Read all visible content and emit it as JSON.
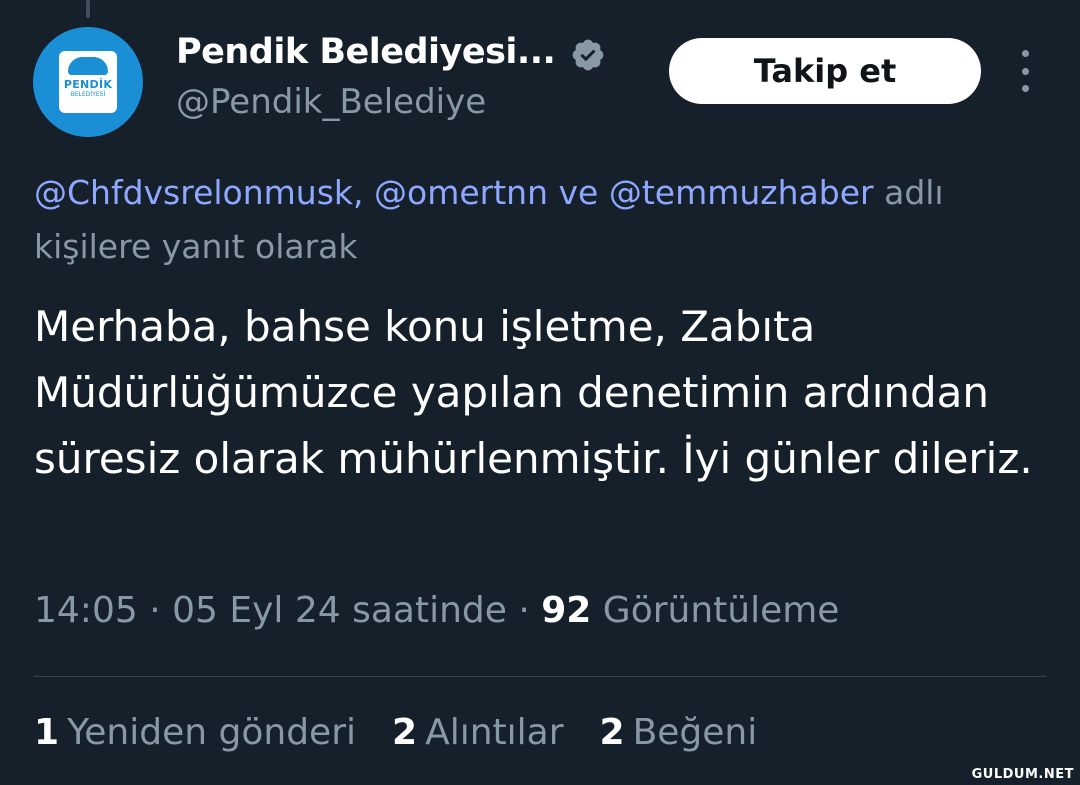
{
  "author": {
    "display_name": "Pendik Belediyesi...",
    "handle": "@Pendik_Belediye",
    "avatar_logo_name": "PENDİK",
    "avatar_logo_sub": "BELEDİYESİ",
    "avatar_color": "#1a8fd6",
    "verified_icon": "verified-badge-icon"
  },
  "follow_button": {
    "label": "Takip et"
  },
  "more_button": {
    "icon": "more-vertical-icon"
  },
  "reply_context": {
    "mentions": [
      "@Chfdvsrelonmusk,",
      "@omertnn",
      "@temmuzhaber"
    ],
    "connector": "ve",
    "suffix": "adlı kişilere yanıt olarak"
  },
  "tweet": {
    "text": "Merhaba, bahse konu işletme, Zabıta Müdürlüğümüzce yapılan denetimin ardından süresiz olarak mühürlenmiştir. İyi günler dileriz."
  },
  "meta": {
    "time_date": "14:05 · 05 Eyl 24 saatinde ·",
    "views_count": "92",
    "views_label": "Görüntüleme"
  },
  "stats": [
    {
      "count": "1",
      "label": "Yeniden gönderi"
    },
    {
      "count": "2",
      "label": "Alıntılar"
    },
    {
      "count": "2",
      "label": "Beğeni"
    }
  ],
  "watermark": "GULDUM.NET",
  "colors": {
    "background": "#15202b",
    "mention": "#8fa8ff",
    "secondary_text": "#8899a6"
  }
}
